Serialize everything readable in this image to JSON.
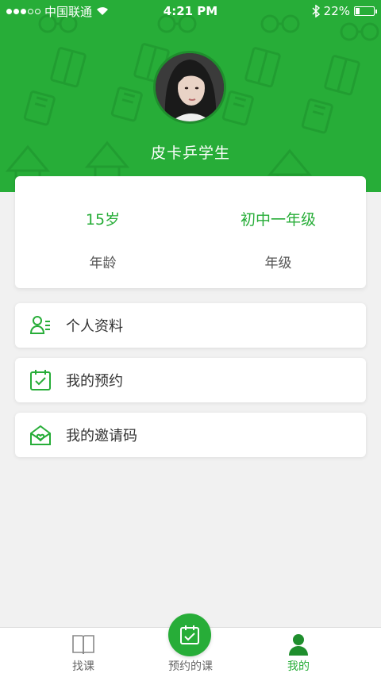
{
  "status_bar": {
    "carrier": "中国联通",
    "time": "4:21 PM",
    "battery": "22%"
  },
  "profile": {
    "name": "皮卡乒学生",
    "avatar_icon": "user-avatar-photo"
  },
  "info_card": {
    "age_value": "15岁",
    "age_label": "年龄",
    "grade_value": "初中一年级",
    "grade_label": "年级"
  },
  "menu": {
    "items": [
      {
        "label": "个人资料",
        "icon": "profile-icon"
      },
      {
        "label": "我的预约",
        "icon": "calendar-check-icon"
      },
      {
        "label": "我的邀请码",
        "icon": "envelope-heart-icon"
      }
    ]
  },
  "tabbar": {
    "tabs": [
      {
        "label": "找课",
        "icon": "book-icon"
      },
      {
        "label": "预约的课",
        "icon": "calendar-check-icon"
      },
      {
        "label": "我的",
        "icon": "person-icon"
      }
    ]
  },
  "colors": {
    "accent": "#27ad38",
    "background": "#f1f1f1"
  }
}
